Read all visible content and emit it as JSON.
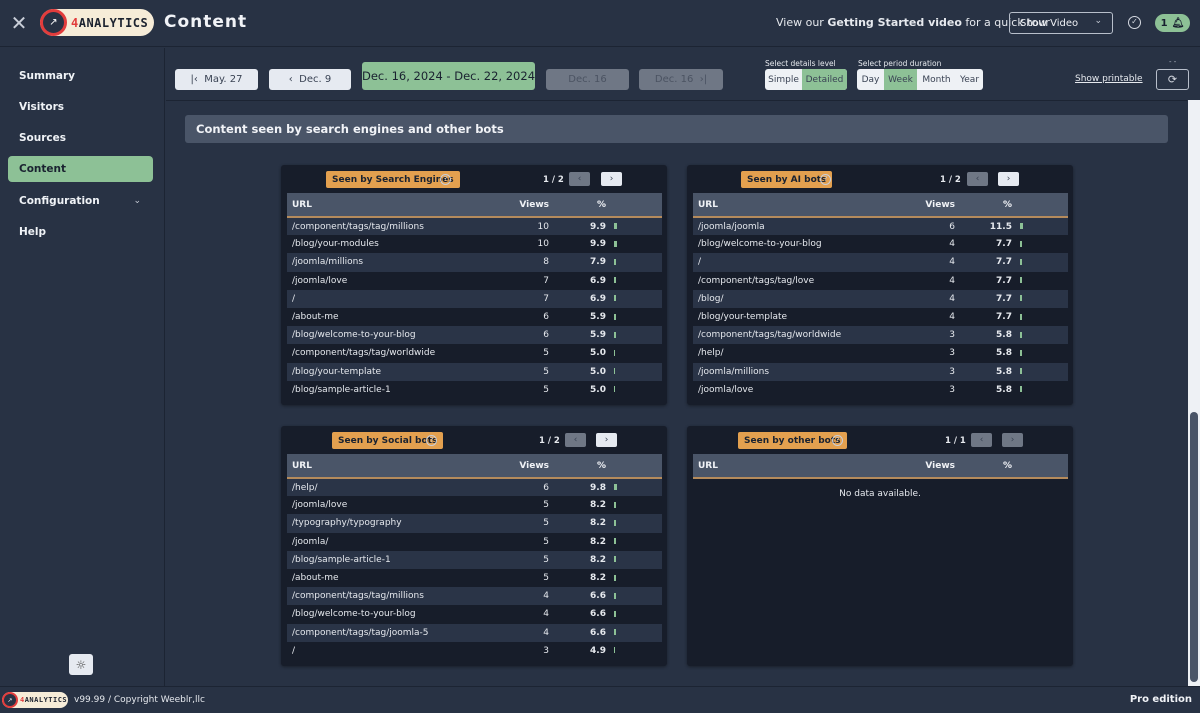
{
  "header": {
    "title": "Content",
    "logo_prefix": "4",
    "logo_text": "ANALYTICS",
    "tour_prefix": "View our ",
    "tour_bold": "Getting Started video",
    "tour_suffix": " for a quick tour",
    "show_video_label": "Show Video",
    "notification_count": "1"
  },
  "sidebar": {
    "items": [
      {
        "label": "Summary",
        "active": false
      },
      {
        "label": "Visitors",
        "active": false
      },
      {
        "label": "Sources",
        "active": false
      },
      {
        "label": "Content",
        "active": true
      },
      {
        "label": "Configuration",
        "active": false,
        "expandable": true
      },
      {
        "label": "Help",
        "active": false
      }
    ]
  },
  "toolbar": {
    "first_label": "May. 27",
    "prev_label": "Dec. 9",
    "current_range": "Dec. 16, 2024 - Dec. 22, 2024",
    "next_label": "Dec. 16",
    "last_label": "Dec. 16",
    "details_level_label": "Select details level",
    "details_options": [
      "Simple",
      "Detailed"
    ],
    "details_selected": "Detailed",
    "period_label": "Select period duration",
    "period_options": [
      "Day",
      "Week",
      "Month",
      "Year"
    ],
    "period_selected": "Week",
    "printable_label": "Show printable",
    "refresh_dots": "- -"
  },
  "section": {
    "title": "Content seen by search engines and other bots"
  },
  "panels": {
    "search": {
      "tag": "Seen by Search Engines",
      "pager": "1 / 2",
      "columns": [
        "URL",
        "Views",
        "%"
      ],
      "rows": [
        {
          "url": "/component/tags/tag/millions",
          "views": "10",
          "pct": "9.9"
        },
        {
          "url": "/blog/your-modules",
          "views": "10",
          "pct": "9.9"
        },
        {
          "url": "/joomla/millions",
          "views": "8",
          "pct": "7.9"
        },
        {
          "url": "/joomla/love",
          "views": "7",
          "pct": "6.9"
        },
        {
          "url": "/",
          "views": "7",
          "pct": "6.9"
        },
        {
          "url": "/about-me",
          "views": "6",
          "pct": "5.9"
        },
        {
          "url": "/blog/welcome-to-your-blog",
          "views": "6",
          "pct": "5.9"
        },
        {
          "url": "/component/tags/tag/worldwide",
          "views": "5",
          "pct": "5.0"
        },
        {
          "url": "/blog/your-template",
          "views": "5",
          "pct": "5.0"
        },
        {
          "url": "/blog/sample-article-1",
          "views": "5",
          "pct": "5.0"
        }
      ]
    },
    "ai": {
      "tag": "Seen by AI bots",
      "pager": "1 / 2",
      "columns": [
        "URL",
        "Views",
        "%"
      ],
      "rows": [
        {
          "url": "/joomla/joomla",
          "views": "6",
          "pct": "11.5"
        },
        {
          "url": "/blog/welcome-to-your-blog",
          "views": "4",
          "pct": "7.7"
        },
        {
          "url": "/",
          "views": "4",
          "pct": "7.7"
        },
        {
          "url": "/component/tags/tag/love",
          "views": "4",
          "pct": "7.7"
        },
        {
          "url": "/blog/",
          "views": "4",
          "pct": "7.7"
        },
        {
          "url": "/blog/your-template",
          "views": "4",
          "pct": "7.7"
        },
        {
          "url": "/component/tags/tag/worldwide",
          "views": "3",
          "pct": "5.8"
        },
        {
          "url": "/help/",
          "views": "3",
          "pct": "5.8"
        },
        {
          "url": "/joomla/millions",
          "views": "3",
          "pct": "5.8"
        },
        {
          "url": "/joomla/love",
          "views": "3",
          "pct": "5.8"
        }
      ]
    },
    "social": {
      "tag": "Seen by Social bots",
      "pager": "1 / 2",
      "columns": [
        "URL",
        "Views",
        "%"
      ],
      "rows": [
        {
          "url": "/help/",
          "views": "6",
          "pct": "9.8"
        },
        {
          "url": "/joomla/love",
          "views": "5",
          "pct": "8.2"
        },
        {
          "url": "/typography/typography",
          "views": "5",
          "pct": "8.2"
        },
        {
          "url": "/joomla/",
          "views": "5",
          "pct": "8.2"
        },
        {
          "url": "/blog/sample-article-1",
          "views": "5",
          "pct": "8.2"
        },
        {
          "url": "/about-me",
          "views": "5",
          "pct": "8.2"
        },
        {
          "url": "/component/tags/tag/millions",
          "views": "4",
          "pct": "6.6"
        },
        {
          "url": "/blog/welcome-to-your-blog",
          "views": "4",
          "pct": "6.6"
        },
        {
          "url": "/component/tags/tag/joomla-5",
          "views": "4",
          "pct": "6.6"
        },
        {
          "url": "/",
          "views": "3",
          "pct": "4.9"
        }
      ]
    },
    "other": {
      "tag": "Seen by other bots",
      "pager": "1 / 1",
      "columns": [
        "URL",
        "Views",
        "%"
      ],
      "rows": [],
      "empty_message": "No data available."
    }
  },
  "footer": {
    "version": "v99.99",
    "separator": "/",
    "copyright": "Copyright Weeblr,llc",
    "edition": "Pro edition"
  },
  "colors": {
    "accent_green": "#8dc196",
    "tag_orange": "#e3a04f",
    "background": "#283244",
    "panel": "#171d2a"
  }
}
